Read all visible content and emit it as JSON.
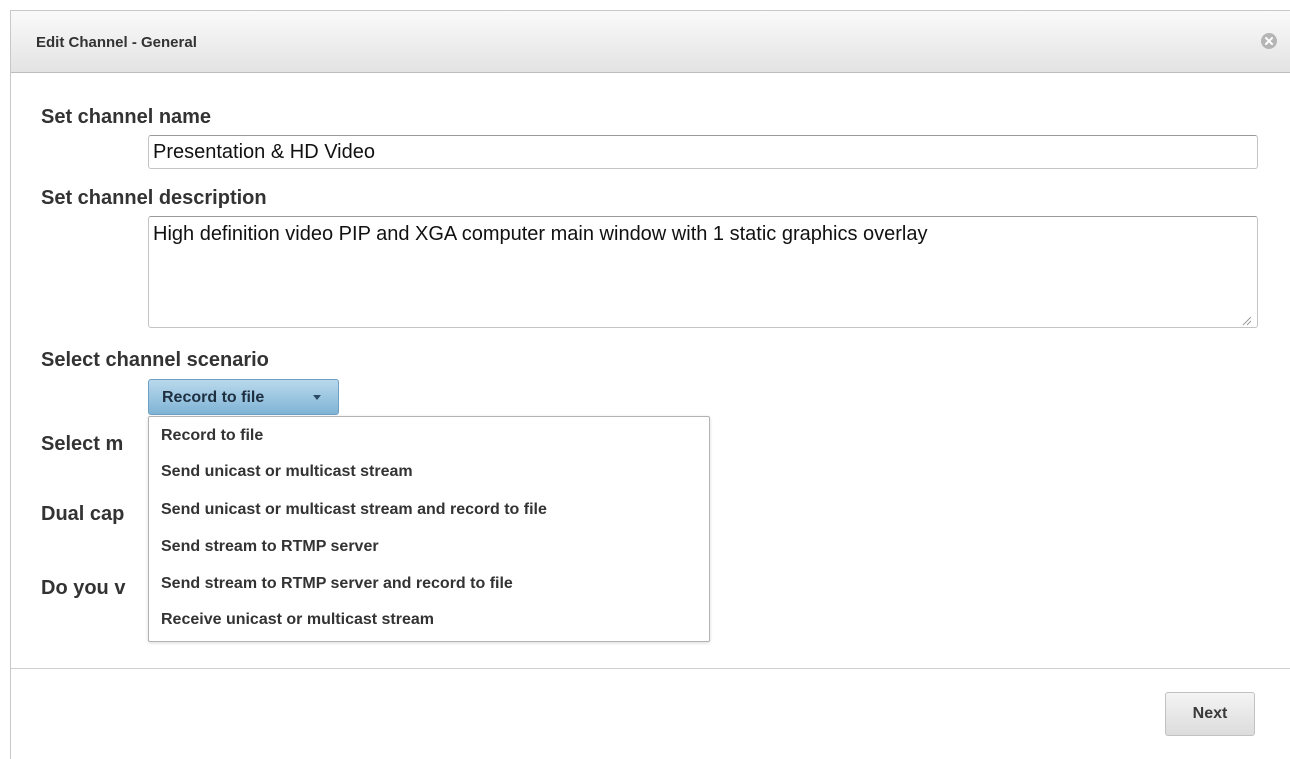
{
  "dialog": {
    "title": "Edit Channel - General",
    "close_icon": "close-circle-icon"
  },
  "fields": {
    "name_label": "Set channel name",
    "name_value": "Presentation & HD Video",
    "description_label": "Set channel description",
    "description_value": "High definition video PIP and XGA computer main window with 1 static graphics overlay",
    "scenario_label": "Select channel scenario",
    "scenario_selected": "Record to file",
    "partial_labels": [
      "Select m",
      "Dual cap",
      "Do you v"
    ]
  },
  "dropdown": {
    "options": [
      "Record to file",
      "Send unicast or multicast stream",
      "Send unicast or multicast stream and record to file",
      "Send stream to RTMP server",
      "Send stream to RTMP server and record to file",
      "Receive unicast or multicast stream"
    ]
  },
  "footer": {
    "next_label": "Next"
  },
  "colors": {
    "select_accent": "#7fb3d5",
    "text": "#333333"
  }
}
